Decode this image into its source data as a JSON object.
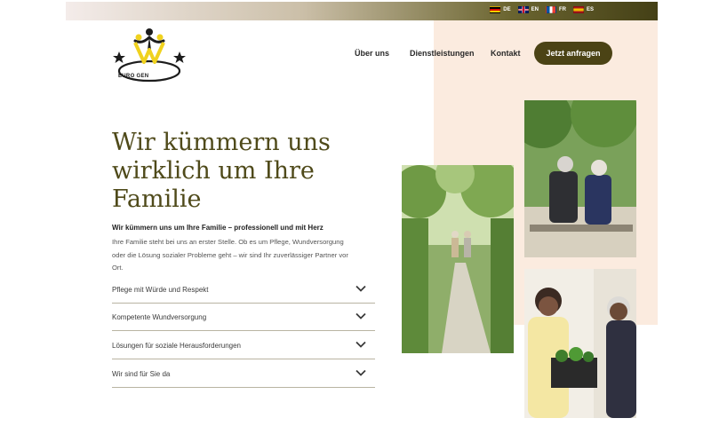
{
  "languages": [
    {
      "code": "DE",
      "flag": "de"
    },
    {
      "code": "EN",
      "flag": "en"
    },
    {
      "code": "FR",
      "flag": "fr"
    },
    {
      "code": "ES",
      "flag": "es"
    }
  ],
  "brand": {
    "logo_text": "EURO GEN",
    "accent": "#4b4315",
    "panel": "#fbebdf",
    "title_color": "#4f4a1a"
  },
  "nav": {
    "about": "Über uns",
    "services": "Dienstleistungen",
    "contact": "Kontakt",
    "cta": "Jetzt anfragen"
  },
  "hero": {
    "title": "Wir kümmern uns wirklich um Ihre Familie",
    "subtitle": "Wir kümmern uns um Ihre Familie – professionell und mit Herz",
    "intro": "Ihre Familie steht bei uns an erster Stelle. Ob es um Pflege, Wundversorgung oder die Lösung sozialer Probleme geht – wir sind Ihr zuverlässiger Partner vor Ort."
  },
  "accordion": [
    {
      "label": "Pflege mit Würde und Respekt",
      "icon": "chevron-down-icon"
    },
    {
      "label": "Kompetente Wundversorgung",
      "icon": "chevron-down-icon"
    },
    {
      "label": "Lösungen für soziale Herausforderungen",
      "icon": "chevron-down-icon"
    },
    {
      "label": "Wir sind für Sie da",
      "icon": "chevron-down-icon"
    }
  ]
}
